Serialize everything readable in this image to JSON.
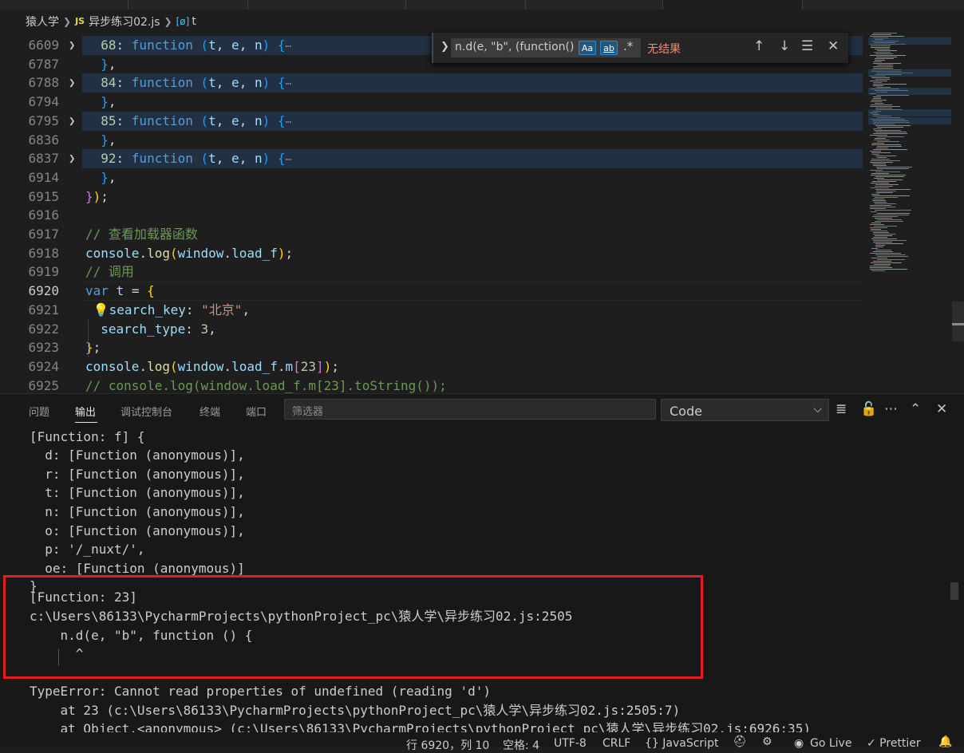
{
  "breadcrumb": {
    "folder": "猿人学",
    "file_badge": "JS",
    "file": "异步练习02.js",
    "symbol_badge": "[ø]",
    "symbol": "t"
  },
  "editor": {
    "lines": [
      {
        "n": "6609",
        "fold": true,
        "segs": [
          [
            "plain",
            "  "
          ],
          [
            "num",
            "68"
          ],
          [
            "plain",
            ": "
          ],
          [
            "kw",
            "function"
          ],
          [
            "plain",
            " "
          ],
          [
            "br3",
            "("
          ],
          [
            "var",
            "t"
          ],
          [
            "plain",
            ", "
          ],
          [
            "var",
            "e"
          ],
          [
            "plain",
            ", "
          ],
          [
            "var",
            "n"
          ],
          [
            "br3",
            ")"
          ],
          [
            "plain",
            " "
          ],
          [
            "br3",
            "{"
          ],
          [
            "dots",
            "⋯"
          ]
        ]
      },
      {
        "n": "6787",
        "segs": [
          [
            "plain",
            "  "
          ],
          [
            "br3",
            "}"
          ],
          [
            "plain",
            ","
          ]
        ]
      },
      {
        "n": "6788",
        "fold": true,
        "segs": [
          [
            "plain",
            "  "
          ],
          [
            "num",
            "84"
          ],
          [
            "plain",
            ": "
          ],
          [
            "kw",
            "function"
          ],
          [
            "plain",
            " "
          ],
          [
            "br3",
            "("
          ],
          [
            "var",
            "t"
          ],
          [
            "plain",
            ", "
          ],
          [
            "var",
            "e"
          ],
          [
            "plain",
            ", "
          ],
          [
            "var",
            "n"
          ],
          [
            "br3",
            ")"
          ],
          [
            "plain",
            " "
          ],
          [
            "br3",
            "{"
          ],
          [
            "dots",
            "⋯"
          ]
        ]
      },
      {
        "n": "6794",
        "segs": [
          [
            "plain",
            "  "
          ],
          [
            "br3",
            "}"
          ],
          [
            "plain",
            ","
          ]
        ]
      },
      {
        "n": "6795",
        "fold": true,
        "segs": [
          [
            "plain",
            "  "
          ],
          [
            "num",
            "85"
          ],
          [
            "plain",
            ": "
          ],
          [
            "kw",
            "function"
          ],
          [
            "plain",
            " "
          ],
          [
            "br3",
            "("
          ],
          [
            "var",
            "t"
          ],
          [
            "plain",
            ", "
          ],
          [
            "var",
            "e"
          ],
          [
            "plain",
            ", "
          ],
          [
            "var",
            "n"
          ],
          [
            "br3",
            ")"
          ],
          [
            "plain",
            " "
          ],
          [
            "br3",
            "{"
          ],
          [
            "dots",
            "⋯"
          ]
        ]
      },
      {
        "n": "6836",
        "segs": [
          [
            "plain",
            "  "
          ],
          [
            "br3",
            "}"
          ],
          [
            "plain",
            ","
          ]
        ]
      },
      {
        "n": "6837",
        "fold": true,
        "segs": [
          [
            "plain",
            "  "
          ],
          [
            "num",
            "92"
          ],
          [
            "plain",
            ": "
          ],
          [
            "kw",
            "function"
          ],
          [
            "plain",
            " "
          ],
          [
            "br3",
            "("
          ],
          [
            "var",
            "t"
          ],
          [
            "plain",
            ", "
          ],
          [
            "var",
            "e"
          ],
          [
            "plain",
            ", "
          ],
          [
            "var",
            "n"
          ],
          [
            "br3",
            ")"
          ],
          [
            "plain",
            " "
          ],
          [
            "br3",
            "{"
          ],
          [
            "dots",
            "⋯"
          ]
        ]
      },
      {
        "n": "6914",
        "segs": [
          [
            "plain",
            "  "
          ],
          [
            "br3",
            "}"
          ],
          [
            "plain",
            ","
          ]
        ]
      },
      {
        "n": "6915",
        "segs": [
          [
            "br2",
            "}"
          ],
          [
            "br1",
            ")"
          ],
          [
            "plain",
            ";"
          ]
        ]
      },
      {
        "n": "6916",
        "segs": []
      },
      {
        "n": "6917",
        "segs": [
          [
            "cmt",
            "// 查看加载器函数"
          ]
        ]
      },
      {
        "n": "6918",
        "segs": [
          [
            "var",
            "console"
          ],
          [
            "plain",
            "."
          ],
          [
            "fn",
            "log"
          ],
          [
            "br1",
            "("
          ],
          [
            "var",
            "window"
          ],
          [
            "plain",
            "."
          ],
          [
            "var",
            "load_f"
          ],
          [
            "br1",
            ")"
          ],
          [
            "plain",
            ";"
          ]
        ]
      },
      {
        "n": "6919",
        "segs": [
          [
            "cmt",
            "// 调用"
          ]
        ]
      },
      {
        "n": "6920",
        "active": true,
        "segs": [
          [
            "kw",
            "var"
          ],
          [
            "plain",
            " "
          ],
          [
            "var",
            "t"
          ],
          [
            "plain",
            " = "
          ],
          [
            "br1",
            "{"
          ]
        ]
      },
      {
        "n": "6921",
        "segs": [
          [
            "plain",
            " 💡"
          ],
          [
            "var",
            "search_key"
          ],
          [
            "plain",
            ": "
          ],
          [
            "str",
            "\"北京\""
          ],
          [
            "plain",
            ","
          ]
        ]
      },
      {
        "n": "6922",
        "segs": [
          [
            "plain",
            "  "
          ],
          [
            "var",
            "search_type"
          ],
          [
            "plain",
            ": "
          ],
          [
            "num",
            "3"
          ],
          [
            "plain",
            ","
          ]
        ]
      },
      {
        "n": "6923",
        "segs": [
          [
            "br1",
            "}"
          ],
          [
            "plain",
            ";"
          ]
        ]
      },
      {
        "n": "6924",
        "segs": [
          [
            "var",
            "console"
          ],
          [
            "plain",
            "."
          ],
          [
            "fn",
            "log"
          ],
          [
            "br1",
            "("
          ],
          [
            "var",
            "window"
          ],
          [
            "plain",
            "."
          ],
          [
            "var",
            "load_f"
          ],
          [
            "plain",
            "."
          ],
          [
            "var",
            "m"
          ],
          [
            "br2",
            "["
          ],
          [
            "num",
            "23"
          ],
          [
            "br2",
            "]"
          ],
          [
            "br1",
            ")"
          ],
          [
            "plain",
            ";"
          ]
        ]
      },
      {
        "n": "6925",
        "segs": [
          [
            "cmt",
            "// console.log(window.load_f.m[23].toString());"
          ]
        ]
      }
    ]
  },
  "find": {
    "value": "n.d(e, \"b\", (function()",
    "match_case": "Aa",
    "whole_word": "ab",
    "regex": ".*",
    "result": "无结果"
  },
  "panel": {
    "tabs": [
      "问题",
      "输出",
      "调试控制台",
      "终端",
      "端口"
    ],
    "filter_placeholder": "筛选器",
    "channel": "Code",
    "output": [
      "[Function: f] {",
      "  d: [Function (anonymous)],",
      "  r: [Function (anonymous)],",
      "  t: [Function (anonymous)],",
      "  n: [Function (anonymous)],",
      "  o: [Function (anonymous)],",
      "  p: '/_nuxt/',",
      "  oe: [Function (anonymous)]",
      "}",
      "[Function: 23]",
      "c:\\Users\\86133\\PycharmProjects\\pythonProject_pc\\猿人学\\异步练习02.js:2505",
      "    n.d(e, \"b\", function () {",
      "      ^",
      "",
      "TypeError: Cannot read properties of undefined (reading 'd')",
      "    at 23 (c:\\Users\\86133\\PycharmProjects\\pythonProject_pc\\猿人学\\异步练习02.js:2505:7)",
      "    at Object.<anonymous> (c:\\Users\\86133\\PycharmProjects\\pythonProject_pc\\猿人学\\异步练习02.js:6926:35)"
    ]
  },
  "status": {
    "position": "行 6920，列 10",
    "spaces": "空格: 4",
    "encoding": "UTF-8",
    "eol": "CRLF",
    "language": "{} JavaScript",
    "golive": "Go Live",
    "prettier": "✓ Prettier"
  }
}
